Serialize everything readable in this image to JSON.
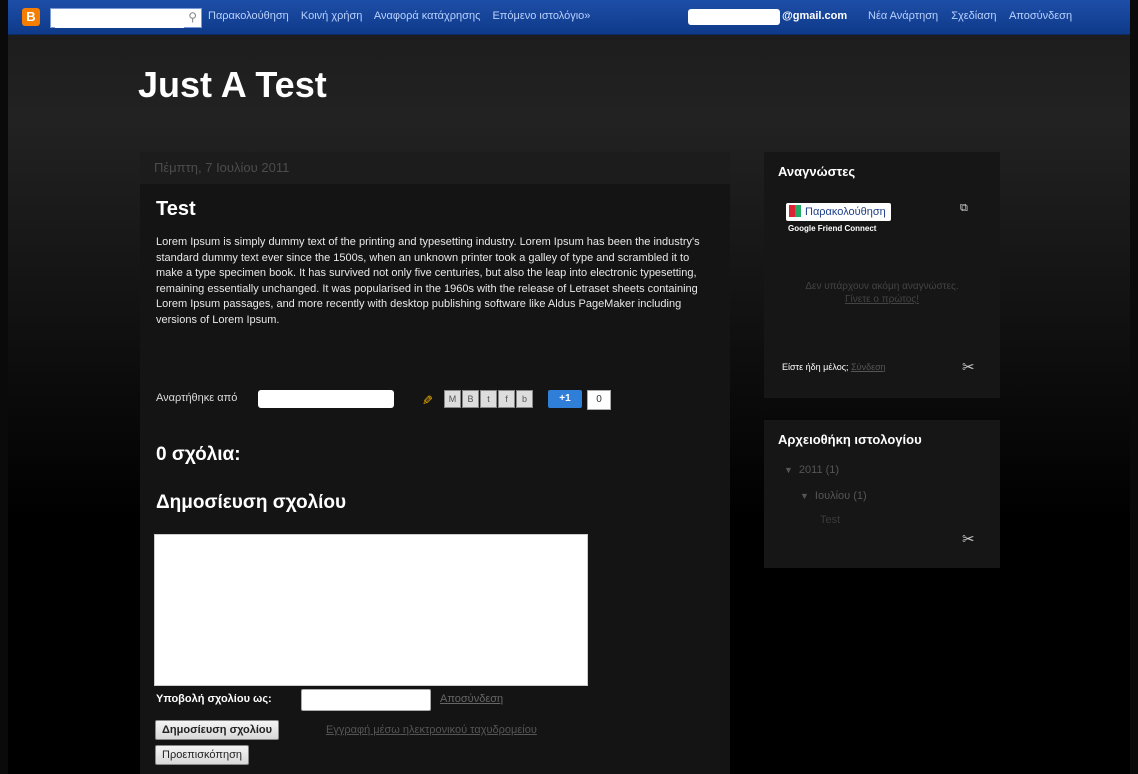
{
  "navbar": {
    "logo": "B",
    "search_placeholder": "",
    "links": [
      "Παρακολούθηση",
      "Κοινή χρήση",
      "Αναφορά κατάχρησης",
      "Επόμενο ιστολόγιο»"
    ],
    "email_suffix": "@gmail.com",
    "right_links": [
      "Νέα Ανάρτηση",
      "Σχεδίαση",
      "Αποσύνδεση"
    ]
  },
  "blog": {
    "title": "Just A Test"
  },
  "post": {
    "date": "Πέμπτη, 7 Ιουλίου 2011",
    "title": "Test",
    "body": "Lorem Ipsum is simply dummy text of the printing and typesetting industry. Lorem Ipsum has been the industry's standard dummy text ever since the 1500s, when an unknown printer took a galley of type and scrambled it to make a type specimen book. It has survived not only five centuries, but also the leap into electronic typesetting, remaining essentially unchanged. It was popularised in the 1960s with the release of Letraset sheets containing Lorem Ipsum passages, and more recently with desktop publishing software like Aldus PageMaker including versions of Lorem Ipsum.",
    "posted_by": "Αναρτήθηκε από",
    "plusone_label": "+1",
    "plusone_count": "0",
    "share_icons": [
      "mail-icon",
      "blogthis-icon",
      "twitter-icon",
      "facebook-icon",
      "buzz-icon"
    ]
  },
  "comments": {
    "count_heading": "0 σχόλια:",
    "post_heading": "Δημοσίευση σχολίου",
    "comment_as": "Υποβολή σχολίου ως:",
    "signout": "Αποσύνδεση",
    "publish_button": "Δημοσίευση σχολίου",
    "subscribe_link": "Εγγραφή μέσω ηλεκτρονικού ταχυδρομείου",
    "preview_button": "Προεπισκόπηση"
  },
  "sidebar": {
    "followers": {
      "title": "Αναγνώστες",
      "follow_button": "Παρακολούθηση",
      "gfc_label": "Google Friend Connect",
      "no_readers": "Δεν υπάρχουν ακόμη αναγνώστες.",
      "become_first": "Γίνετε ο πρώτος!",
      "already_member": "Είστε ήδη μέλος;",
      "signin": "Σύνδεση"
    },
    "archive": {
      "title": "Αρχειοθήκη ιστολογίου",
      "year": "2011",
      "year_count": "(1)",
      "month": "Ιουλίου",
      "month_count": "(1)",
      "post": "Test"
    }
  }
}
